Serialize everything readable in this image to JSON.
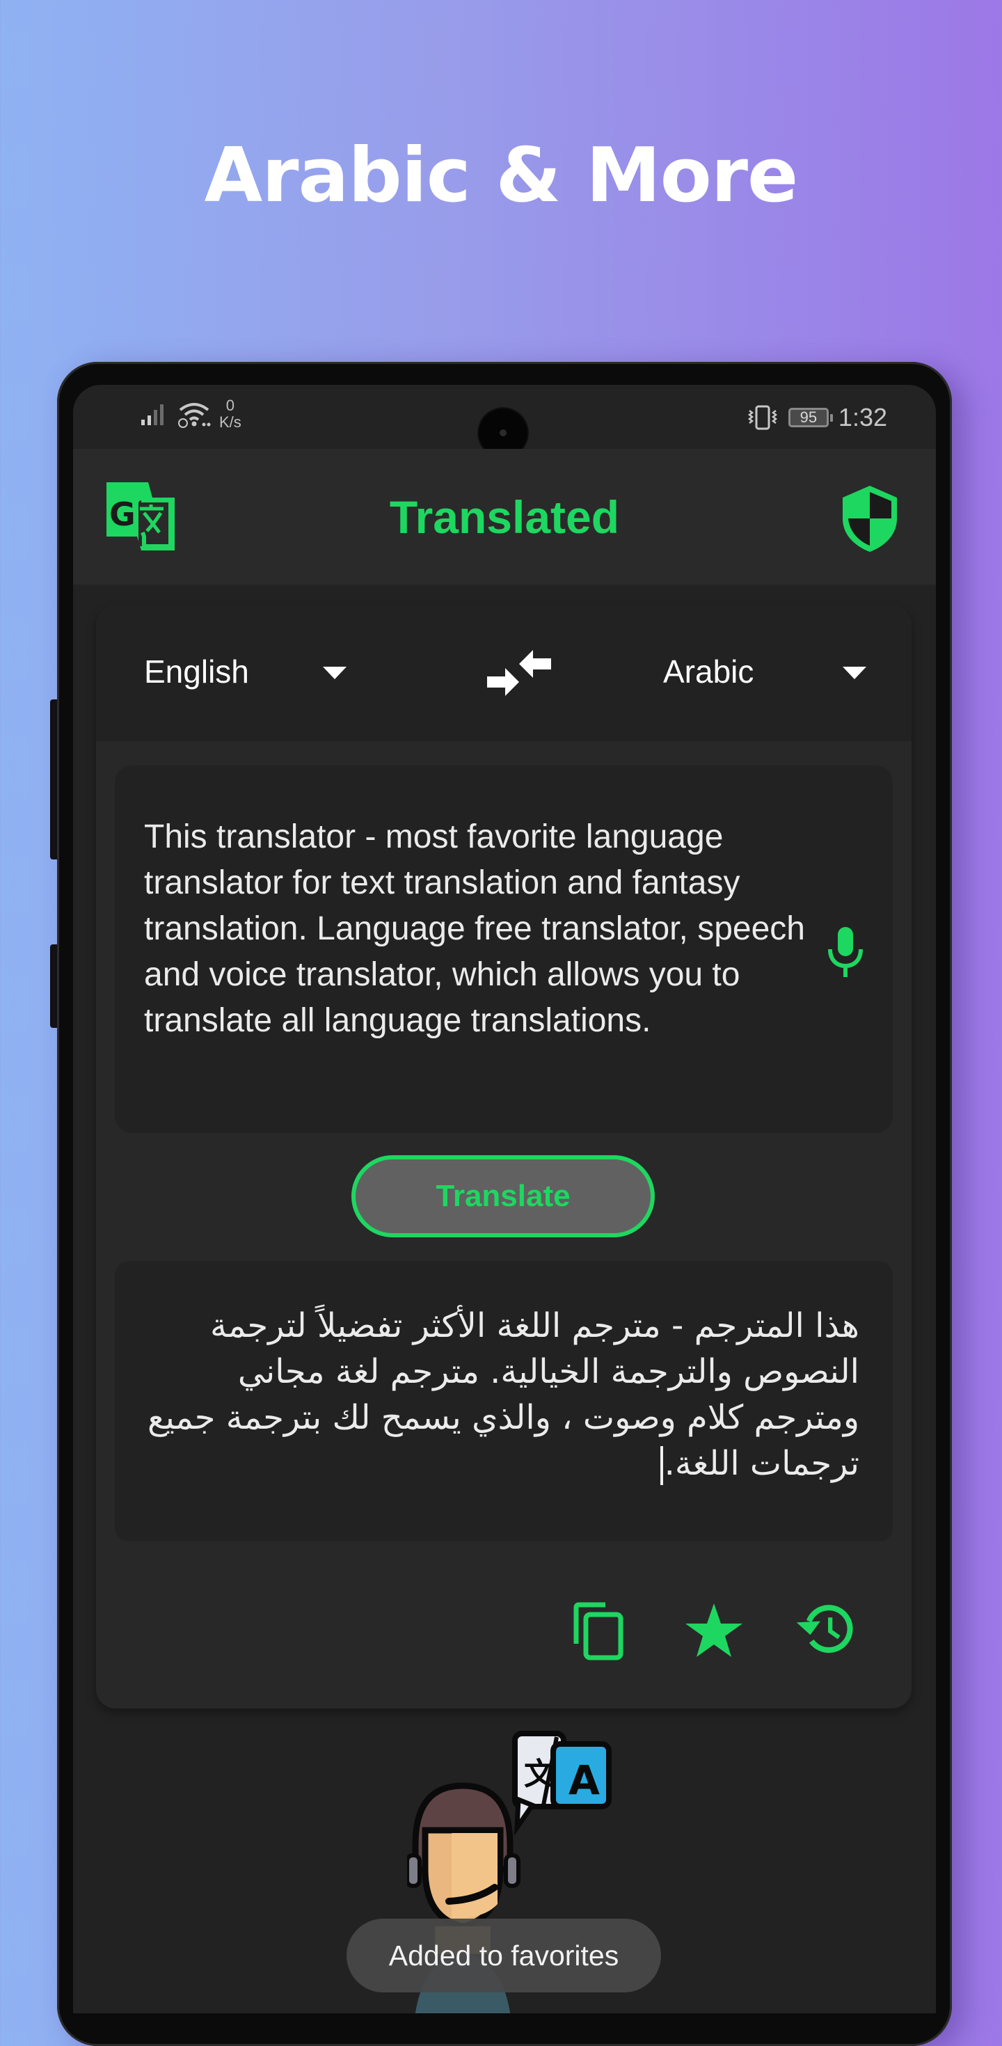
{
  "hero": {
    "title": "Arabic & More"
  },
  "status_bar": {
    "net_speed_value": "0",
    "net_speed_unit": "K/s",
    "battery": "95",
    "time": "1:32",
    "icons": [
      "signal-icon",
      "wifi-icon",
      "vibrate-icon",
      "battery-icon"
    ]
  },
  "app_bar": {
    "title": "Translated",
    "logo_icon": "translate-logo-icon",
    "right_icon": "shield-icon"
  },
  "languages": {
    "source": "English",
    "target": "Arabic",
    "swap_icon": "swap-arrows-icon"
  },
  "input": {
    "text": "This translator - most favorite language translator for text translation and fantasy translation. Language free translator, speech and voice translator, which allows you to translate all language translations.",
    "mic_icon": "microphone-icon"
  },
  "translate_button": {
    "label": "Translate"
  },
  "output": {
    "text": "هذا المترجم - مترجم اللغة الأكثر تفضيلاً لترجمة النصوص والترجمة الخيالية. مترجم لغة مجاني ومترجم كلام وصوت ، والذي يسمح لك بترجمة جميع ترجمات اللغة."
  },
  "actions": [
    {
      "name": "copy",
      "icon": "copy-icon"
    },
    {
      "name": "favorite",
      "icon": "star-icon"
    },
    {
      "name": "history",
      "icon": "history-icon"
    }
  ],
  "toast": {
    "message": "Added to favorites"
  },
  "colors": {
    "accent": "#1ed760",
    "background": "#222222",
    "app_bar": "#2a2a2a",
    "card": "#282828",
    "button_fill": "#616161"
  }
}
